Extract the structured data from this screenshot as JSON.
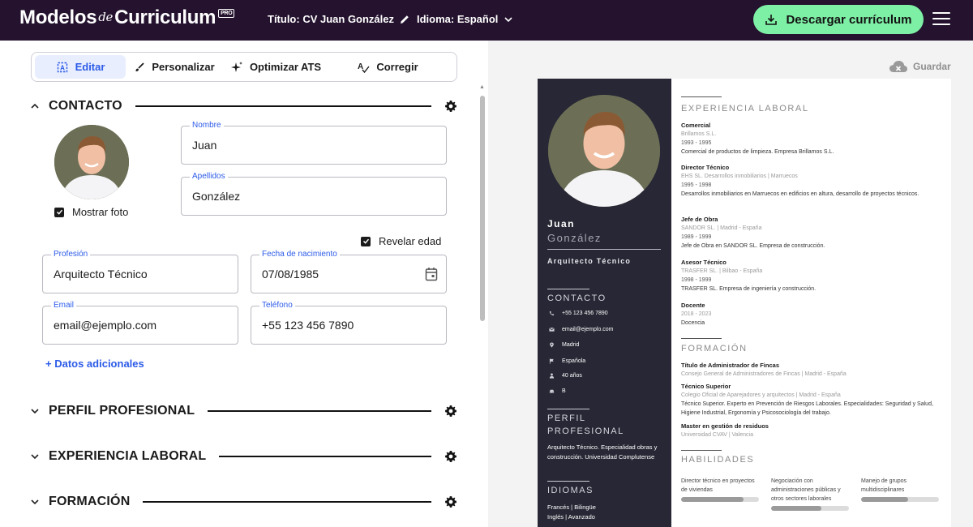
{
  "header": {
    "logo_main": "Modelos",
    "logo_de": "de",
    "logo_cv": "Curriculum",
    "logo_badge": "PRO",
    "title_label": "Título: CV Juan González",
    "language_label": "Idioma: Español",
    "download_label": "Descargar currículum"
  },
  "tabs": [
    {
      "label": "Editar",
      "icon": "edit-icon",
      "active": true
    },
    {
      "label": "Personalizar",
      "icon": "brush-icon",
      "active": false
    },
    {
      "label": "Optimizar ATS",
      "icon": "sparkle-icon",
      "active": false
    },
    {
      "label": "Corregir",
      "icon": "spellcheck-icon",
      "active": false
    }
  ],
  "sections": {
    "contact": "CONTACTO",
    "profile": "PERFIL PROFESIONAL",
    "experience": "EXPERIENCIA LABORAL",
    "education": "FORMACIÓN"
  },
  "form": {
    "show_photo_label": "Mostrar foto",
    "show_photo_checked": true,
    "reveal_age_label": "Revelar edad",
    "reveal_age_checked": true,
    "name_label": "Nombre",
    "name_value": "Juan",
    "surname_label": "Apellidos",
    "surname_value": "González",
    "profession_label": "Profesión",
    "profession_value": "Arquitecto Técnico",
    "birth_label": "Fecha de nacimiento",
    "birth_value": "07/08/1985",
    "email_label": "Email",
    "email_value": "email@ejemplo.com",
    "phone_label": "Teléfono",
    "phone_value": "+55 123 456 7890",
    "additional_label": "+ Datos adicionales"
  },
  "preview": {
    "save_label": "Guardar",
    "first_name": "Juan",
    "last_name": "González",
    "profession": "Arquitecto Técnico",
    "contact_heading": "CONTACTO",
    "contact_items": [
      {
        "icon": "phone-icon",
        "text": "+55 123 456 7890"
      },
      {
        "icon": "mail-icon",
        "text": "email@ejemplo.com"
      },
      {
        "icon": "location-icon",
        "text": "Madrid"
      },
      {
        "icon": "flag-icon",
        "text": "Española"
      },
      {
        "icon": "person-icon",
        "text": "40 años"
      },
      {
        "icon": "car-icon",
        "text": "B"
      }
    ],
    "profile_heading_1": "PERFIL",
    "profile_heading_2": "PROFESIONAL",
    "profile_text": "Arquitecto Técnico. Especialidad obras y construcción. Universidad Complutense",
    "languages_heading": "IDIOMAS",
    "languages": [
      "Francés | Bilingüe",
      "Inglés | Avanzado"
    ],
    "experience_heading": "EXPERIENCIA LABORAL",
    "jobs": [
      {
        "title": "Comercial",
        "company": "Brillamos S.L.",
        "dates": "1993 - 1995",
        "desc": "Comercial de productos de limpieza. Empresa Brillamos S.L."
      },
      {
        "title": "Director Técnico",
        "company": "EHS SL. Desarrollos inmobiliarios | Marruecos",
        "dates": "1995 - 1998",
        "desc": "Desarrollos inmobiliarios en Marruecos en edificios en altura, desarrollo de proyectos técnicos."
      },
      {
        "title": "Jefe de Obra",
        "company": "SANDOR SL. | Madrid - España",
        "dates": "1989 - 1999",
        "desc": "Jefe de Obra en SANDOR SL. Empresa de construcción."
      },
      {
        "title": "Asesor Técnico",
        "company": "TRASFER SL. | Bilbao - España",
        "dates": "1998 - 1999",
        "desc": "TRASFER SL. Empresa de ingeniería y construcción."
      },
      {
        "title": "Docente",
        "company": "",
        "dates": "2018 - 2023",
        "desc": "Docencia"
      }
    ],
    "education_heading": "FORMACIÓN",
    "education": [
      {
        "title": "Título de Administrador de Fincas",
        "place": "Consejo General de Administradores de Fincas | Madrid - España",
        "desc": ""
      },
      {
        "title": "Técnico Superior",
        "place": "Colegio Oficial de Aparejadores y arquitectos | Madrid - España",
        "desc": "Técnico Superior. Experto en Prevención de Riesgos Laborales. Especialidades: Seguridad y Salud, Higiene Industrial, Ergonomía y Psicosociología del trabajo."
      },
      {
        "title": "Master en gestión de residuos",
        "place": "Universidad CVAV | Valencia",
        "desc": ""
      }
    ],
    "skills_heading": "HABILIDADES",
    "skills": [
      {
        "text": "Director técnico en proyectos de viviendas",
        "level": 0.8
      },
      {
        "text": "Negociación con administraciones públicas y otros sectores laborales",
        "level": 0.65
      },
      {
        "text": "Manejo de grupos multidisciplinares",
        "level": 0.6
      }
    ]
  },
  "colors": {
    "topbar": "#24122e",
    "accent": "#2c5be8",
    "download": "#7ef0a6",
    "cv_sidebar": "#272735"
  }
}
